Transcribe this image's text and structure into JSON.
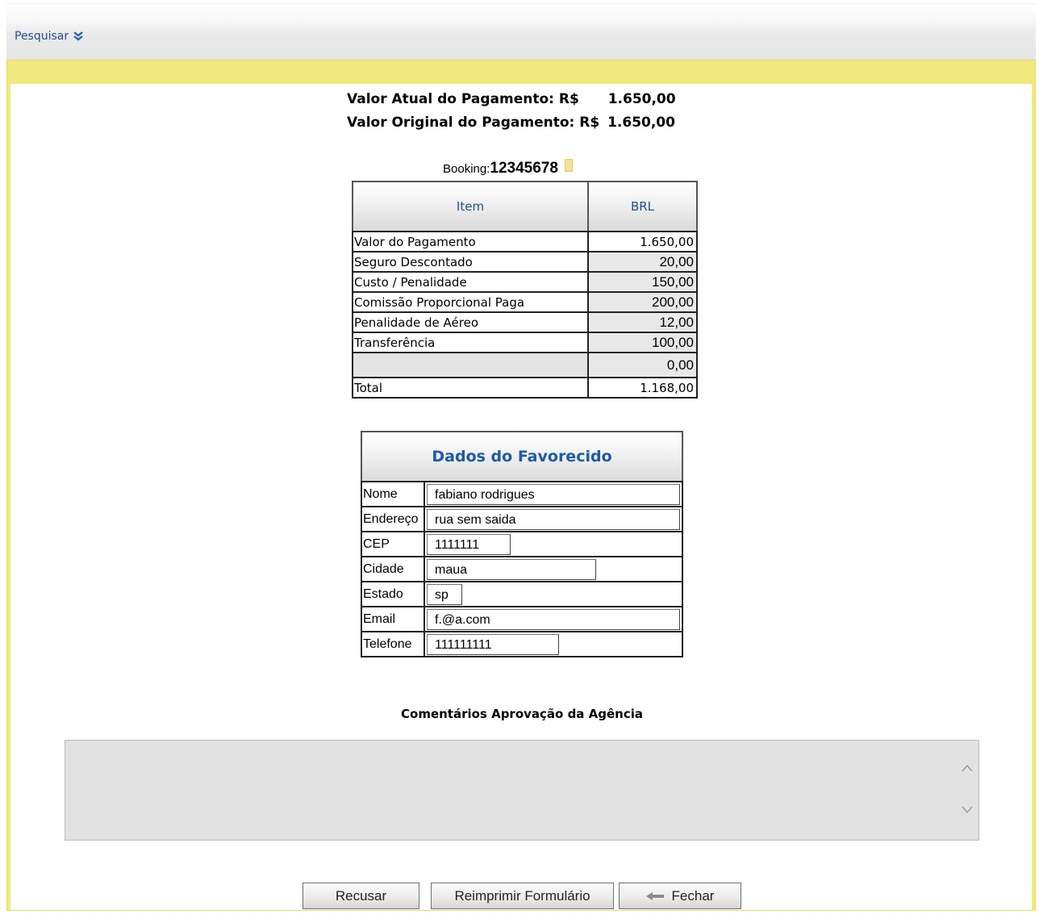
{
  "header": {
    "search_label": "Pesquisar",
    "search_icon": "double-chevron-down-icon"
  },
  "summary": {
    "current_label": "Valor Atual do Pagamento: R$",
    "current_value": "1.650,00",
    "original_label": "Valor Original do Pagamento: R$",
    "original_value": "1.650,00"
  },
  "booking": {
    "label": "Booking:",
    "value": "12345678",
    "icon": "note-icon"
  },
  "items_table": {
    "headers": [
      "Item",
      "BRL"
    ],
    "rows": [
      {
        "label": "Valor do Pagamento",
        "value": "1.650,00"
      },
      {
        "label": "Seguro Descontado",
        "value": "20,00"
      },
      {
        "label": "Custo / Penalidade",
        "value": "150,00"
      },
      {
        "label": "Comissão Proporcional Paga",
        "value": "200,00"
      },
      {
        "label": "Penalidade de Aéreo",
        "value": "12,00"
      },
      {
        "label": "Transferência",
        "value": "100,00"
      },
      {
        "label": "",
        "value": "0,00"
      },
      {
        "label": "Total",
        "value": "1.168,00"
      }
    ]
  },
  "favorecido": {
    "title": "Dados do Favorecido",
    "fields": [
      {
        "label": "Nome",
        "value": "fabiano rodrigues"
      },
      {
        "label": "Endereço",
        "value": "rua sem saida"
      },
      {
        "label": "CEP",
        "value": "1111111"
      },
      {
        "label": "Cidade",
        "value": "maua"
      },
      {
        "label": "Estado",
        "value": "sp"
      },
      {
        "label": "Email",
        "value": "f.@a.com"
      },
      {
        "label": "Telefone",
        "value": "111111111"
      }
    ]
  },
  "comments": {
    "title": "Comentários Aprovação da Agência",
    "value": ""
  },
  "buttons": {
    "reject": "Recusar",
    "reprint": "Reimprimir Formulário",
    "close": "Fechar"
  },
  "colors": {
    "link_blue": "#1d4f93",
    "frame_yellow": "#f1e97d",
    "readonly_gray": "#e8e8e8"
  }
}
